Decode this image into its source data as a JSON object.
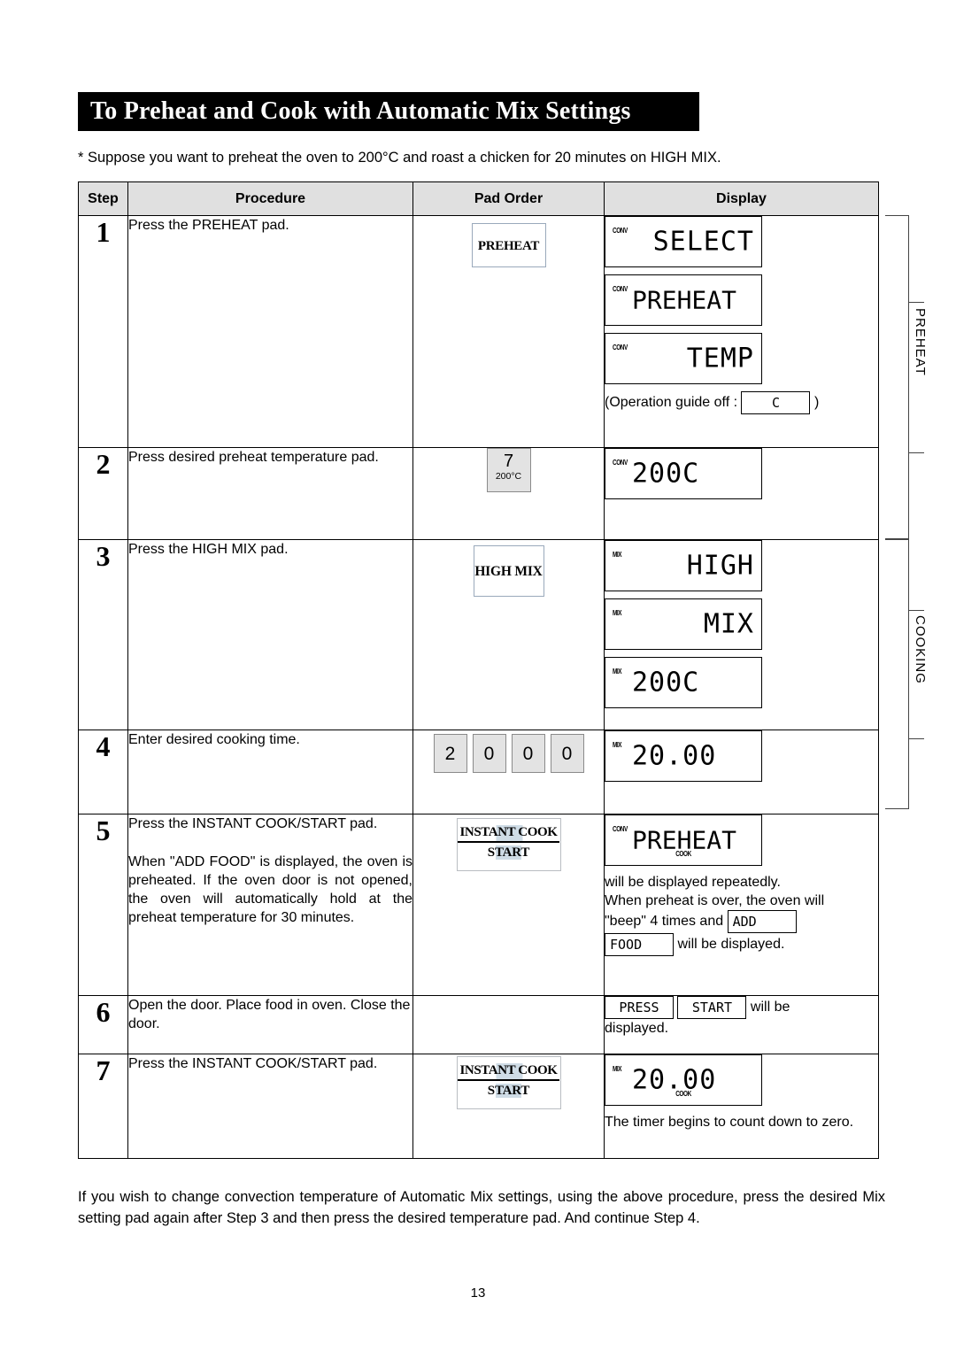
{
  "document": {
    "title": "To Preheat and Cook with Automatic Mix Settings",
    "intro": "* Suppose you want to preheat the oven to 200°C and roast a chicken for 20 minutes on HIGH MIX.",
    "footer_note": "If you wish to change convection temperature of Automatic Mix settings, using the above procedure, press the desired Mix setting pad again after Step 3 and then press the desired temperature pad. And continue Step 4.",
    "page_number": "13"
  },
  "table": {
    "headers": {
      "step": "Step",
      "procedure": "Procedure",
      "pad_order": "Pad Order",
      "display": "Display"
    },
    "rows": [
      {
        "step": "1",
        "procedure": "Press the PREHEAT pad.",
        "pad": {
          "type": "preheat",
          "label": "PREHEAT"
        },
        "displays": [
          {
            "indicator_top": "CONV",
            "text": "SELECT"
          },
          {
            "indicator_top": "CONV",
            "text": "PREHEAT"
          },
          {
            "indicator_top": "CONV",
            "text": "TEMP"
          }
        ],
        "note_prefix": "(Operation guide off :",
        "note_mini": "C",
        "note_suffix": ")"
      },
      {
        "step": "2",
        "procedure": "Press desired preheat temperature pad.",
        "pad": {
          "type": "temp",
          "number": "7",
          "sub": "200°C"
        },
        "displays": [
          {
            "indicator_top": "CONV",
            "text": "200C"
          }
        ]
      },
      {
        "step": "3",
        "procedure": "Press the HIGH MIX pad.",
        "pad": {
          "type": "highmix",
          "label": "HIGH MIX"
        },
        "displays": [
          {
            "indicator_top": "MIX",
            "text": "HIGH"
          },
          {
            "indicator_top": "MIX",
            "text": "MIX"
          },
          {
            "indicator_top": "MIX",
            "text": "200C"
          }
        ]
      },
      {
        "step": "4",
        "procedure": "Enter desired cooking time.",
        "pad": {
          "type": "numbers",
          "keys": [
            "2",
            "0",
            "0",
            "0"
          ]
        },
        "displays": [
          {
            "indicator_top": "MIX",
            "text": "20.00"
          }
        ]
      },
      {
        "step": "5",
        "procedure_1": "Press the INSTANT COOK/START pad.",
        "procedure_2": "When \"ADD FOOD\" is displayed, the oven is preheated. If the oven door is not opened, the oven will automatically hold at the preheat temperature for 30 minutes.",
        "pad": {
          "type": "instant",
          "line1": "INSTANT COOK",
          "line2": "START"
        },
        "displays": [
          {
            "indicator_top": "CONV",
            "indicator_bottom": "COOK",
            "text": "PREHEAT"
          }
        ],
        "note_line1": "will be displayed repeatedly.",
        "note_line2": "When preheat is over, the oven will",
        "note_line3_a": "\"beep\"  4  times  and",
        "note_mini_1": "ADD",
        "note_mini_2": "FOOD",
        "note_line3_b": "will be displayed."
      },
      {
        "step": "6",
        "procedure": "Open the door. Place food in oven. Close the door.",
        "pad": null,
        "note_mini_1": "PRESS",
        "note_mini_2": "START",
        "note_line_a": "will be",
        "note_line_b": "displayed."
      },
      {
        "step": "7",
        "procedure": "Press the INSTANT COOK/START pad.",
        "pad": {
          "type": "instant",
          "line1": "INSTANT COOK",
          "line2": "START"
        },
        "displays": [
          {
            "indicator_top": "MIX",
            "indicator_bottom": "COOK",
            "text": "20.00"
          }
        ],
        "note_line": "The timer begins to count  down to zero."
      }
    ]
  },
  "brackets": [
    {
      "label": "PREHEAT"
    },
    {
      "label": "COOKING"
    }
  ]
}
